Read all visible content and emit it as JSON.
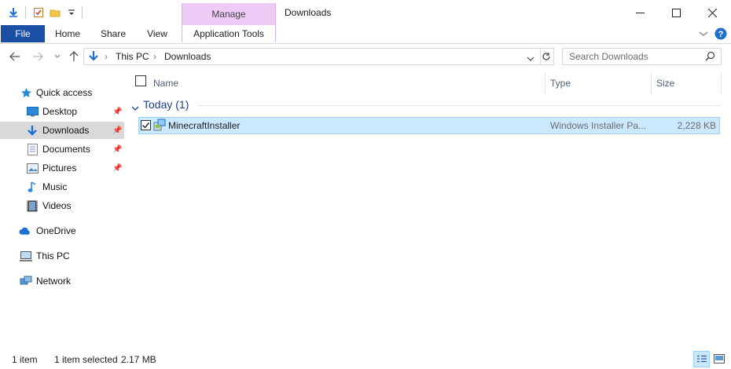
{
  "titlebar": {
    "manage_tab": "Manage",
    "window_title": "Downloads"
  },
  "ribbon": {
    "tabs": [
      "File",
      "Home",
      "Share",
      "View",
      "Application Tools"
    ]
  },
  "address": {
    "segments": [
      "This PC",
      "Downloads"
    ],
    "search_placeholder": "Search Downloads"
  },
  "sidebar": {
    "quick_access": "Quick access",
    "items": [
      {
        "label": "Desktop",
        "pinned": true,
        "icon": "desktop-icon"
      },
      {
        "label": "Downloads",
        "pinned": true,
        "icon": "downloads-icon",
        "selected": true
      },
      {
        "label": "Documents",
        "pinned": true,
        "icon": "documents-icon"
      },
      {
        "label": "Pictures",
        "pinned": true,
        "icon": "pictures-icon"
      },
      {
        "label": "Music",
        "pinned": false,
        "icon": "music-icon"
      },
      {
        "label": "Videos",
        "pinned": false,
        "icon": "videos-icon"
      }
    ],
    "onedrive": "OneDrive",
    "this_pc": "This PC",
    "network": "Network"
  },
  "filelist": {
    "columns": [
      "Name",
      "Type",
      "Size"
    ],
    "group": "Today (1)",
    "files": [
      {
        "name": "MinecraftInstaller",
        "type": "Windows Installer Pa...",
        "size": "2,228 KB",
        "checked": true
      }
    ]
  },
  "status": {
    "count": "1 item",
    "selection": "1 item selected",
    "selection_size": "2.17 MB"
  },
  "colors": {
    "file_tab": "#1a4fa5",
    "manage_tab": "#eecbf7",
    "selection": "#cce8ff",
    "group_text": "#1e3f8a"
  }
}
